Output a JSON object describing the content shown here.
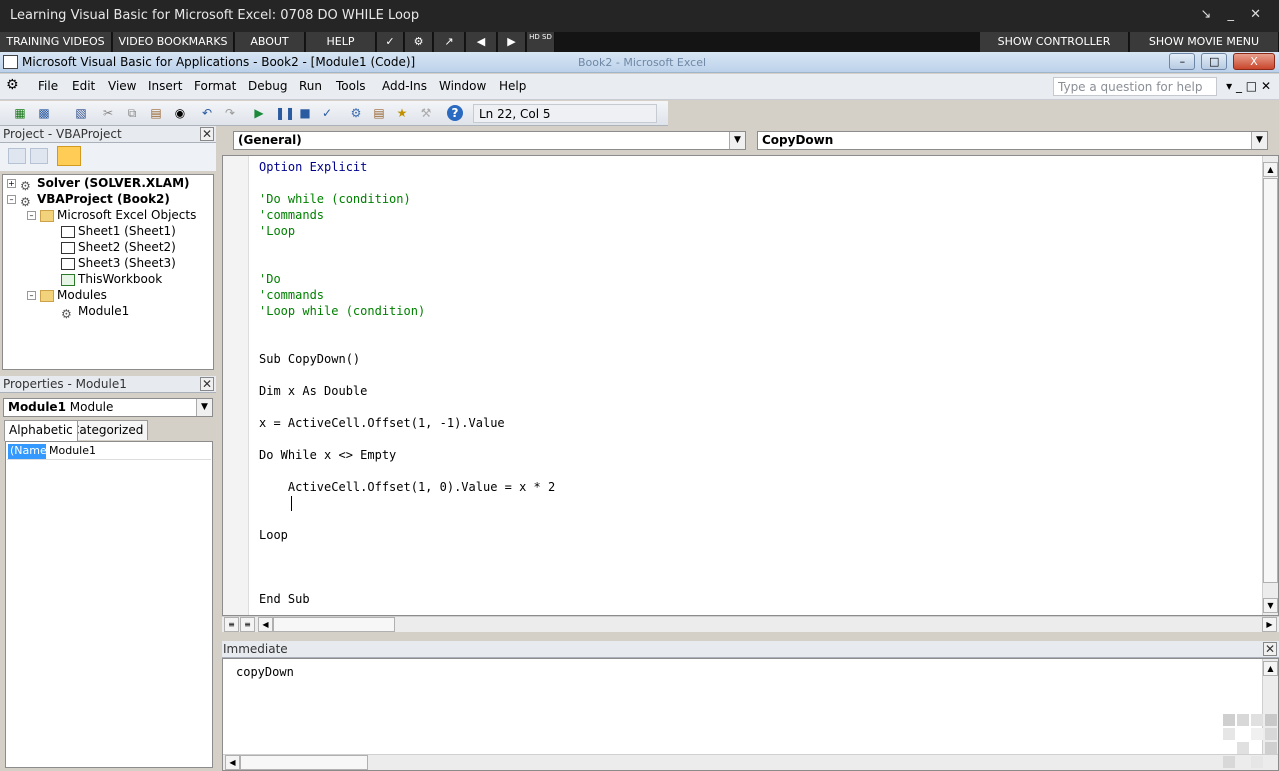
{
  "player": {
    "title": "Learning Visual Basic for Microsoft Excel: 0708 DO WHILE Loop",
    "window_controls": "↘ _ ✕",
    "menu": {
      "training_videos": "TRAINING VIDEOS",
      "video_bookmarks": "VIDEO BOOKMARKS",
      "about": "ABOUT",
      "help": "HELP",
      "check_icon": "✓",
      "settings_icon": "⚙",
      "popout_icon": "↗",
      "prev_icon": "◀",
      "next_icon": "▶",
      "hd_label": "HD SD",
      "show_controller": "SHOW CONTROLLER",
      "show_movie_menu": "SHOW MOVIE MENU"
    }
  },
  "vba_window": {
    "title": "Microsoft Visual Basic for Applications - Book2 - [Module1 (Code)]",
    "background_title": "Book2 - Microsoft Excel",
    "controls": {
      "minimize": "–",
      "restore": "□",
      "close": "X"
    }
  },
  "menubar": {
    "items": [
      "File",
      "Edit",
      "View",
      "Insert",
      "Format",
      "Debug",
      "Run",
      "Tools",
      "Add-Ins",
      "Window",
      "Help"
    ],
    "help_placeholder": "Type a question for help",
    "right_controls": "▾  _  □  ✕"
  },
  "toolbar": {
    "position": "Ln 22, Col 5"
  },
  "project_pane": {
    "title": "Project - VBAProject",
    "tree": [
      "Solver (SOLVER.XLAM)",
      "VBAProject (Book2)",
      "Microsoft Excel Objects",
      "Sheet1 (Sheet1)",
      "Sheet2 (Sheet2)",
      "Sheet3 (Sheet3)",
      "ThisWorkbook",
      "Modules",
      "Module1"
    ]
  },
  "properties_pane": {
    "title": "Properties - Module1",
    "object_bold": "Module1",
    "object_type": "Module",
    "tabs": [
      "Alphabetic",
      "Categorized"
    ],
    "prop_name": "(Name)",
    "prop_value": "Module1"
  },
  "code_window": {
    "general_dropdown": "(General)",
    "proc_dropdown": "CopyDown",
    "lines": [
      "Option Explicit",
      "",
      "'Do while (condition)",
      "'commands",
      "'Loop",
      "",
      "",
      "'Do",
      "'commands",
      "'Loop while (condition)",
      "",
      "",
      "Sub CopyDown()",
      "",
      "Dim x As Double",
      "",
      "x = ActiveCell.Offset(1, -1).Value",
      "",
      "Do While x <> Empty",
      "",
      "    ActiveCell.Offset(1, 0).Value = x * 2",
      "",
      "",
      "Loop",
      "",
      "",
      "",
      "End Sub"
    ]
  },
  "immediate": {
    "title": "Immediate",
    "content": "copyDown"
  }
}
